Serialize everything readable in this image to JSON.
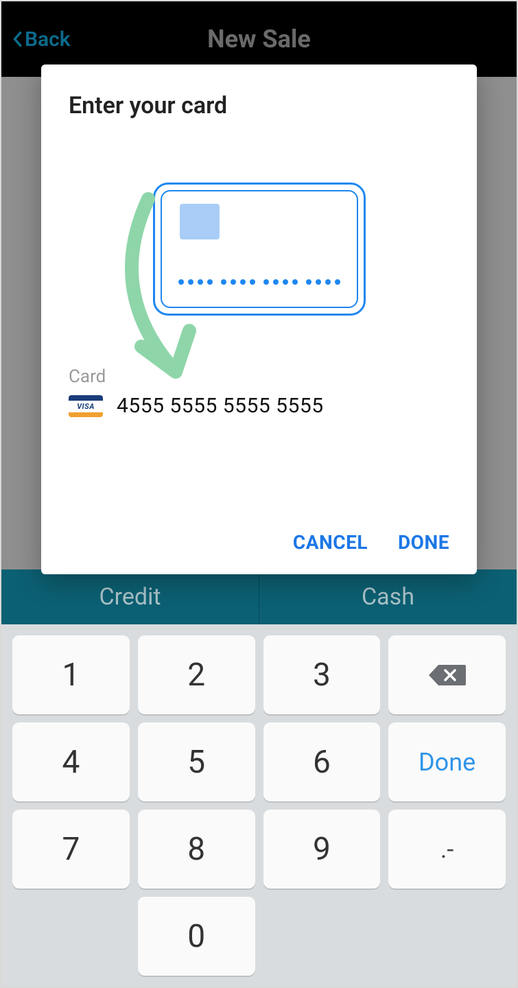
{
  "header": {
    "back_label": "Back",
    "title": "New Sale"
  },
  "tabs": {
    "credit": "Credit",
    "cash": "Cash"
  },
  "modal": {
    "title": "Enter your card",
    "card_label": "Card",
    "card_brand": "VISA",
    "card_number": "4555 5555 5555 5555",
    "cancel": "CANCEL",
    "done": "DONE"
  },
  "keypad": {
    "k1": "1",
    "k2": "2",
    "k3": "3",
    "k4": "4",
    "k5": "5",
    "k6": "6",
    "k7": "7",
    "k8": "8",
    "k9": "9",
    "k0": "0",
    "sym": ".-",
    "done": "Done"
  }
}
